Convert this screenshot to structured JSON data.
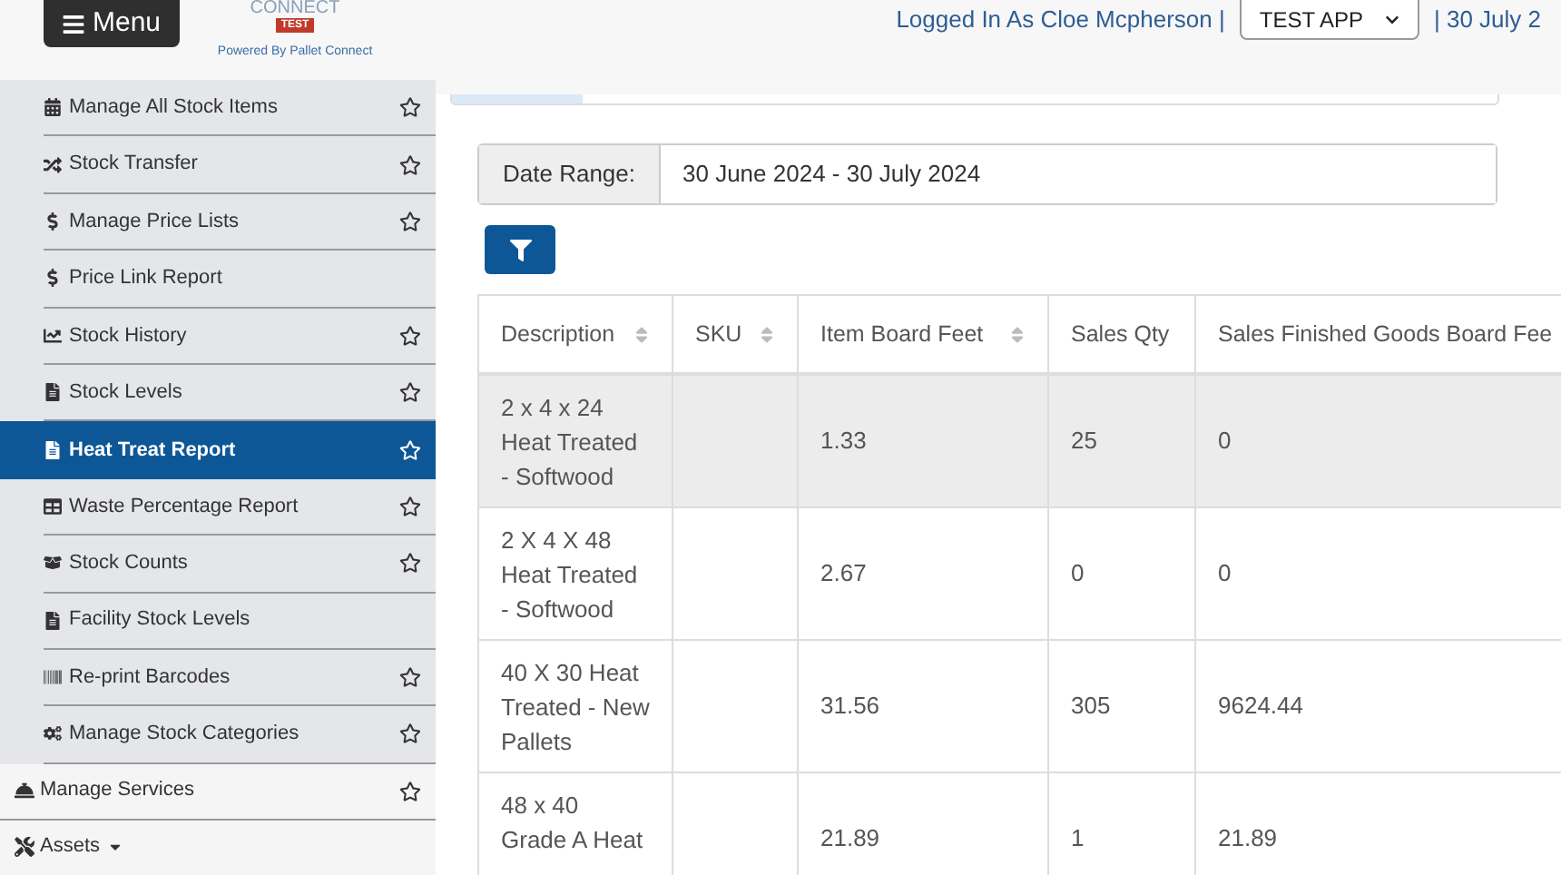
{
  "header": {
    "menu_button": "Menu",
    "logo_text": "CONNECT",
    "logo_badge": "TEST",
    "powered_by": "Powered By Pallet Connect",
    "logged_in": "Logged In As Cloe Mcpherson |",
    "app_select": "TEST APP",
    "date": "| 30 July 2"
  },
  "sidebar": {
    "sub_items": [
      {
        "label": "Manage All Stock Items",
        "starred": true,
        "selected": false
      },
      {
        "label": "Stock Transfer",
        "starred": true,
        "selected": false
      },
      {
        "label": "Manage Price Lists",
        "starred": true,
        "selected": false
      },
      {
        "label": "Price Link Report",
        "starred": false,
        "selected": false
      },
      {
        "label": "Stock History",
        "starred": true,
        "selected": false
      },
      {
        "label": "Stock Levels",
        "starred": true,
        "selected": false
      },
      {
        "label": "Heat Treat Report",
        "starred": true,
        "selected": true
      },
      {
        "label": "Waste Percentage Report",
        "starred": true,
        "selected": false
      },
      {
        "label": "Stock Counts",
        "starred": true,
        "selected": false
      },
      {
        "label": "Facility Stock Levels",
        "starred": false,
        "selected": false
      },
      {
        "label": "Re-print Barcodes",
        "starred": true,
        "selected": false
      },
      {
        "label": "Manage Stock Categories",
        "starred": true,
        "selected": false
      }
    ],
    "items": [
      {
        "label": "Manage Services",
        "starred": true,
        "expandable": false
      },
      {
        "label": "Assets",
        "starred": false,
        "expandable": true
      }
    ]
  },
  "filter": {
    "label": "Date Range:",
    "value": "30 June 2024 - 30 July 2024"
  },
  "table": {
    "columns": [
      {
        "label": "Description",
        "sortable": true
      },
      {
        "label": "SKU",
        "sortable": true
      },
      {
        "label": "Item Board Feet",
        "sortable": true
      },
      {
        "label": "Sales Qty",
        "sortable": false
      },
      {
        "label": "Sales Finished Goods Board Fee",
        "sortable": false
      }
    ],
    "rows": [
      {
        "selected": true,
        "cells": [
          "2 x 4 x 24 Heat Treated - Softwood",
          "",
          "1.33",
          "25",
          "0"
        ]
      },
      {
        "selected": false,
        "cells": [
          "2 X 4 X 48 Heat Treated - Softwood",
          "",
          "2.67",
          "0",
          "0"
        ]
      },
      {
        "selected": false,
        "cells": [
          "40 X 30 Heat Treated - New Pallets",
          "",
          "31.56",
          "305",
          "9624.44"
        ]
      },
      {
        "selected": false,
        "cells": [
          "48 x 40 Grade A Heat",
          "",
          "21.89",
          "1",
          "21.89"
        ]
      }
    ]
  }
}
